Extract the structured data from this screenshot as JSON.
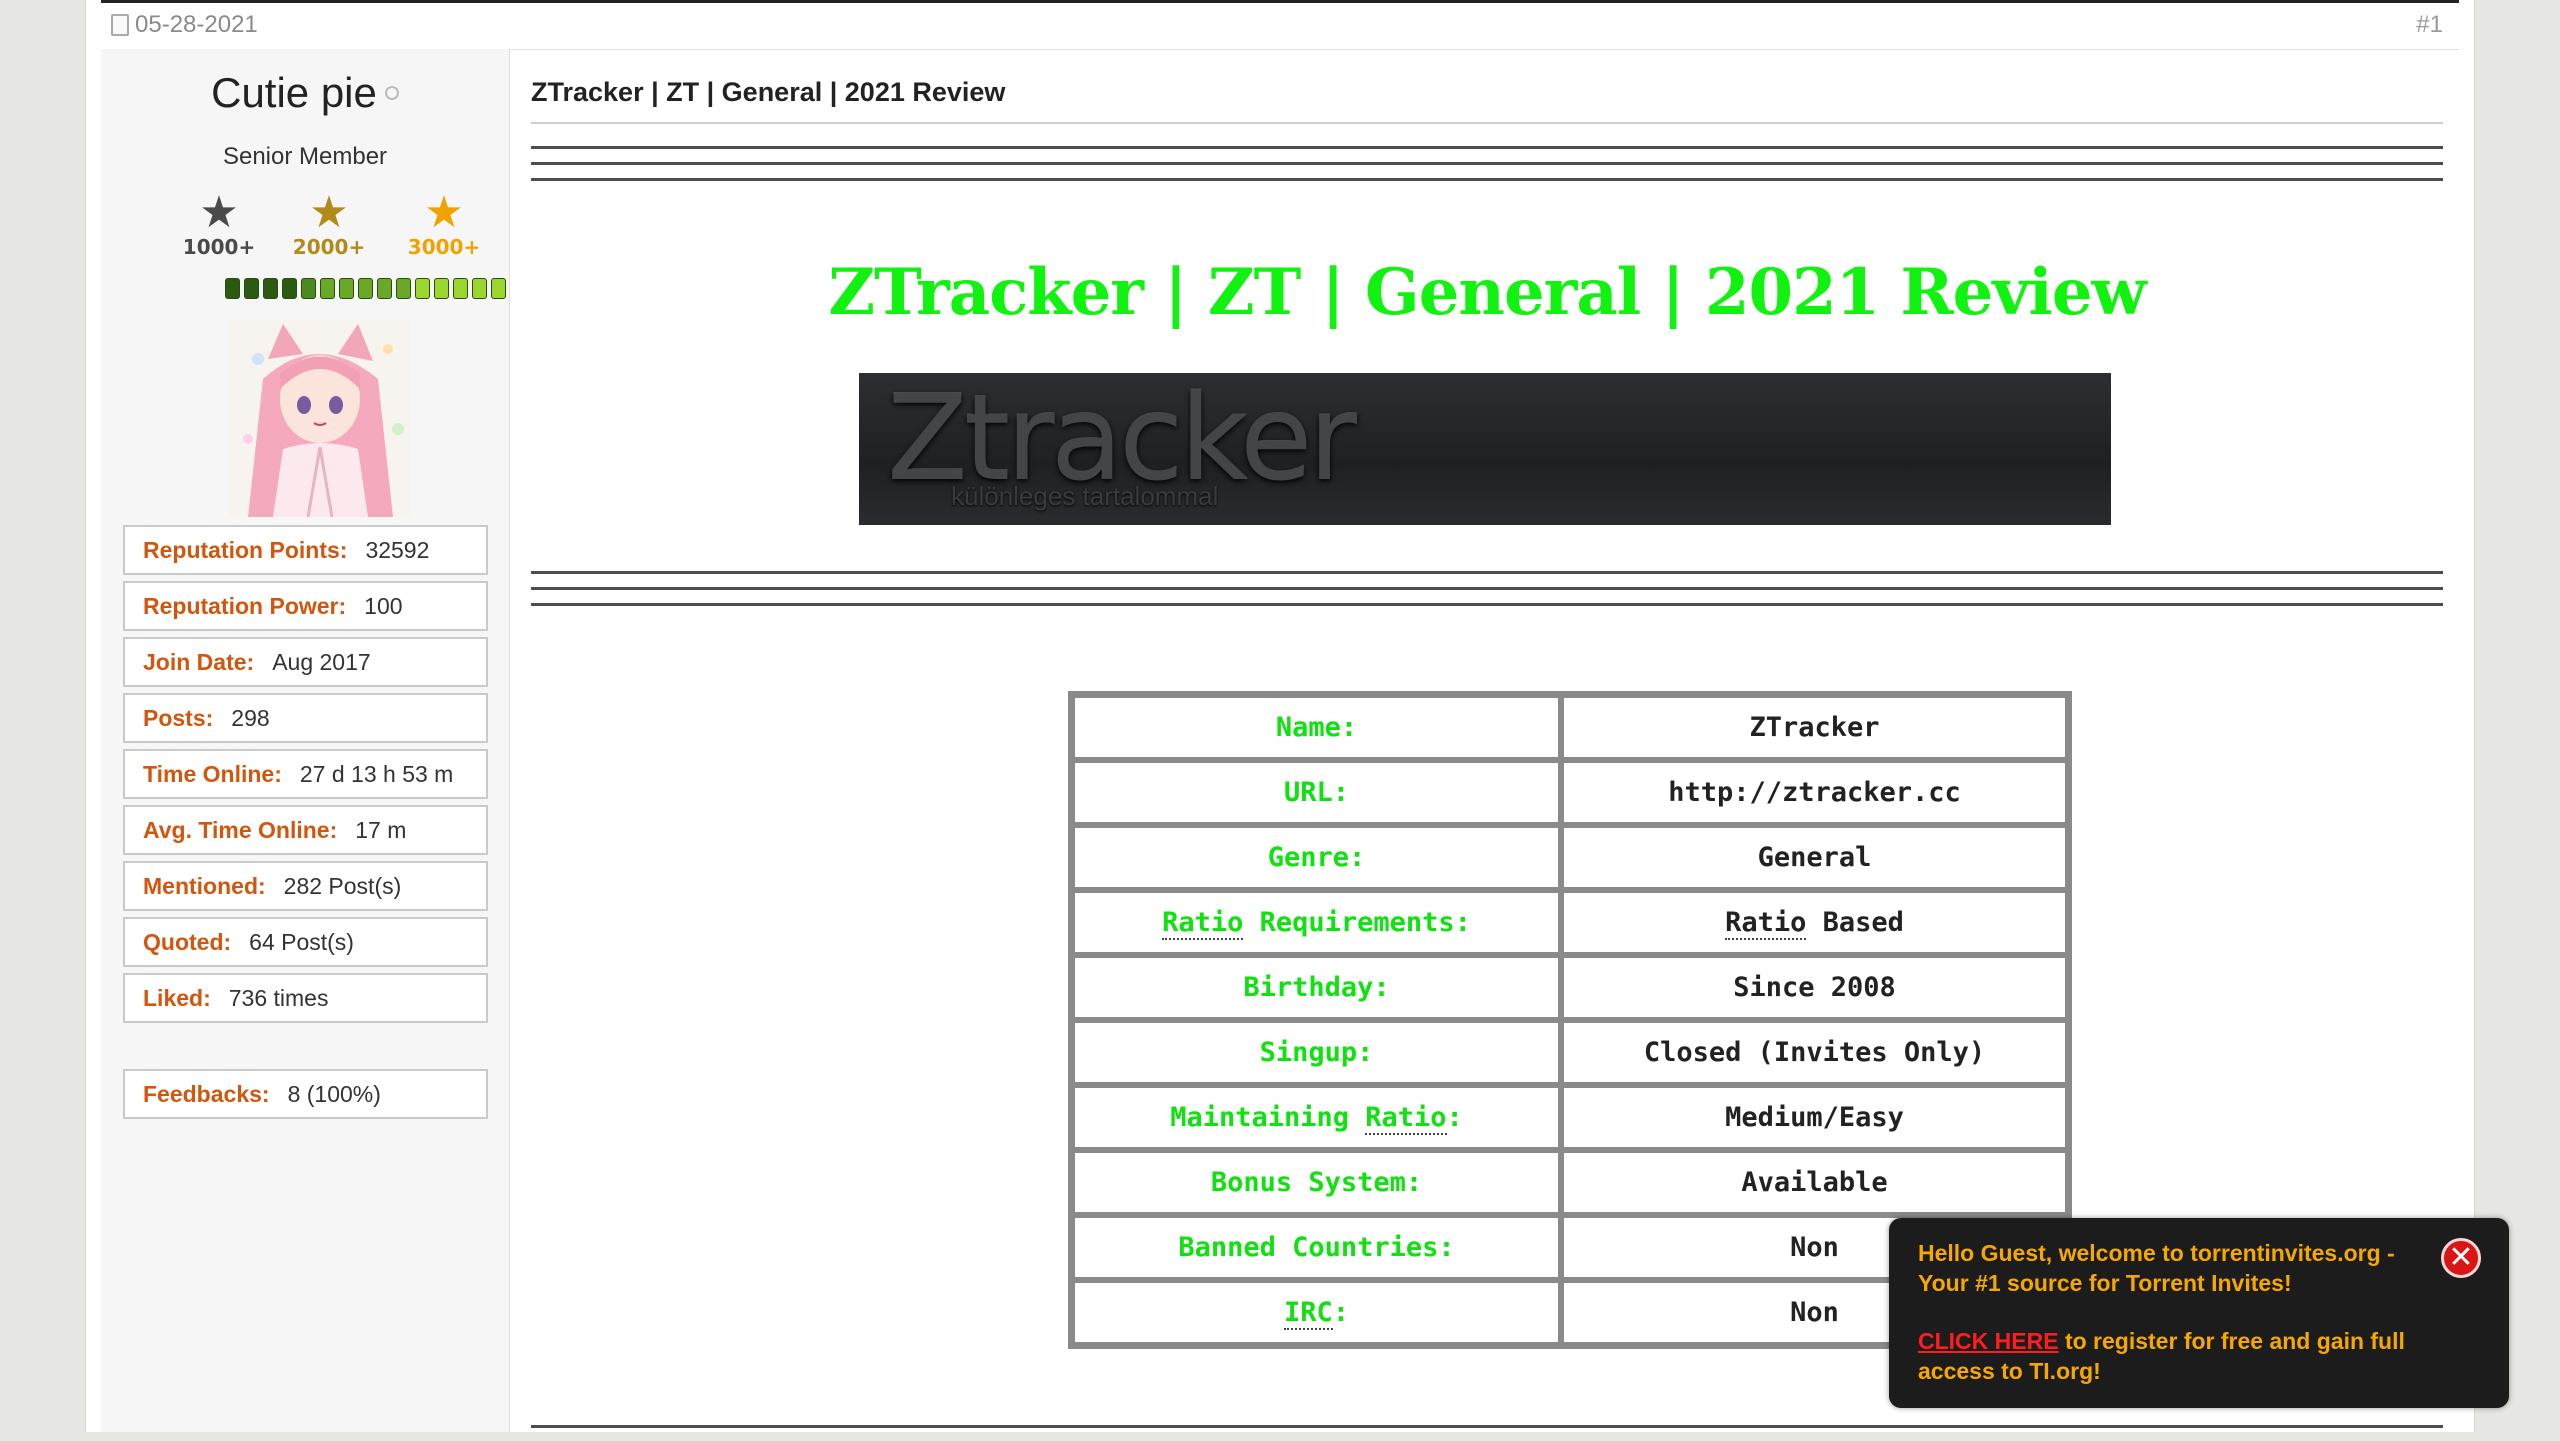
{
  "post": {
    "date": "05-28-2021",
    "number": "#1",
    "title": "ZTracker | ZT | General | 2021 Review"
  },
  "user": {
    "name": "Cutie pie",
    "title": "Senior Member",
    "ranks": [
      {
        "label": "1000+",
        "color": "#4a4a4a"
      },
      {
        "label": "2000+",
        "color": "#b08a1a"
      },
      {
        "label": "3000+",
        "color": "#f0a300"
      }
    ],
    "reputation_bar_segments": [
      "#2d5a12",
      "#2d5a12",
      "#2d5a12",
      "#2d5a12",
      "#4a8a1e",
      "#6aa828",
      "#6aa828",
      "#6aa828",
      "#6aa828",
      "#6aa828",
      "#9ad62e",
      "#9ad62e",
      "#9ad62e",
      "#9ad62e",
      "#9ad62e"
    ],
    "stats": [
      {
        "label": "Reputation Points:",
        "value": "32592"
      },
      {
        "label": "Reputation Power:",
        "value": "100"
      },
      {
        "label": "Join Date:",
        "value": "Aug 2017"
      },
      {
        "label": "Posts:",
        "value": "298"
      },
      {
        "label": "Time Online:",
        "value": "27 d 13 h 53 m"
      },
      {
        "label": "Avg. Time Online:",
        "value": "17 m"
      },
      {
        "label": "Mentioned:",
        "value": "282 Post(s)"
      },
      {
        "label": "Quoted:",
        "value": "64 Post(s)"
      },
      {
        "label": "Liked:",
        "value": "736 times"
      }
    ],
    "feedbacks": {
      "label": "Feedbacks:",
      "value": "8 (100%)"
    }
  },
  "review": {
    "heading": "ZTracker | ZT | General | 2021 Review",
    "banner_logo": "Ztracker",
    "banner_tagline": "különleges tartalommal",
    "rows": [
      {
        "key": "Name:",
        "value": "ZTracker"
      },
      {
        "key": "URL:",
        "value": "http://ztracker.cc"
      },
      {
        "key": "Genre:",
        "value": "General"
      },
      {
        "key_abbr": "Ratio",
        "key_rest": " Requirements:",
        "value_abbr": "Ratio",
        "value_rest": " Based"
      },
      {
        "key": "Birthday:",
        "value": "Since 2008"
      },
      {
        "key": "Singup:",
        "value": "Closed (Invites Only)"
      },
      {
        "key_pre": "Maintaining ",
        "key_abbr": "Ratio",
        "key_rest": ":",
        "value": "Medium/Easy"
      },
      {
        "key": "Bonus System:",
        "value": "Available"
      },
      {
        "key": "Banned Countries:",
        "value": "Non"
      },
      {
        "key_abbr": "IRC",
        "key_rest": ":",
        "value": "Non"
      }
    ],
    "colors": {
      "heading": "#11f211",
      "key_text": "#11e011"
    }
  },
  "guest_notice": {
    "line1": "Hello Guest, welcome to torrentinvites.org - Your #1 source for Torrent Invites!",
    "cta": "CLICK HERE",
    "line2": " to register for free and gain full access to TI.org!",
    "close_icon": "close-icon"
  }
}
